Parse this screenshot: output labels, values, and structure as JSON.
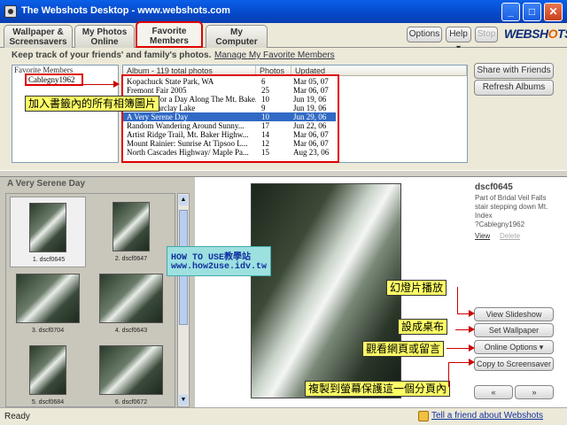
{
  "window": {
    "title": "The Webshots Desktop  -  www.webshots.com"
  },
  "tabs": [
    {
      "line1": "Wallpaper &",
      "line2": "Screensavers"
    },
    {
      "line1": "My Photos",
      "line2": "Online"
    },
    {
      "line1": "Favorite",
      "line2": "Members"
    },
    {
      "line1": "My",
      "line2": "Computer"
    }
  ],
  "toolbar": {
    "options": "Options",
    "help": "Help ▾",
    "stop": "Stop"
  },
  "logo": {
    "part1": "WEBSH",
    "part2": "O",
    "part3": "TS"
  },
  "favorites": {
    "tagline": "Keep track of your friends' and family's photos.",
    "manage_link": "Manage My Favorite Members",
    "members_header": "Favorite Members",
    "members": [
      "Cablegny1962"
    ],
    "share_button": "Share with Friends",
    "refresh_button": "Refresh Albums"
  },
  "albums": {
    "columns": [
      "Album - 119 total photos",
      "Photos",
      "Updated"
    ],
    "rows": [
      {
        "name": "Kopachuck State Park, WA",
        "photos": "6",
        "updated": "Mar 05, 07"
      },
      {
        "name": "Fremont Fair 2005",
        "photos": "25",
        "updated": "Mar 06, 07"
      },
      {
        "name": "Stopping for a Day Along The Mt. Bake...",
        "photos": "10",
        "updated": "Jun 19, 06"
      },
      {
        "name": "Hike to Barclay Lake",
        "photos": "9",
        "updated": "Jun 19, 06"
      },
      {
        "name": "A Very Serene Day",
        "photos": "10",
        "updated": "Jun 29, 06"
      },
      {
        "name": "Random Wandering Around Sunny...",
        "photos": "17",
        "updated": "Jun 22, 06"
      },
      {
        "name": "Artist Ridge Trail, Mt. Baker Highw...",
        "photos": "14",
        "updated": "Mar 06, 07"
      },
      {
        "name": "Mount Rainier: Sunrise At Tipsoo L...",
        "photos": "12",
        "updated": "Mar 06, 07"
      },
      {
        "name": "North Cascades Highway/ Maple Pa...",
        "photos": "15",
        "updated": "Aug 23, 06"
      }
    ]
  },
  "annotations": {
    "add_albums": "加入書籤內的所有相簿圖片",
    "slideshow": "幻燈片播放",
    "wallpaper": "設成桌布",
    "online": "觀看網頁或留言",
    "screensaver": "複製到螢幕保護這一個分頁內",
    "watermark_line1": "HOW TO USE教學站",
    "watermark_line2": "www.how2use.idv.tw"
  },
  "album_view": {
    "title": "A Very Serene Day",
    "thumbs": [
      "1. dscf0645",
      "2. dscf0647",
      "3. dscf0704",
      "4. dscf0643",
      "5. dscf0684",
      "6. dscf0672"
    ]
  },
  "photo": {
    "name": "dscf0645",
    "description": "Part of Bridal Veil Falls stair stepping down Mt. Index",
    "credit": "?Cablegny1962",
    "view_link": "View",
    "delete_link": "Delete"
  },
  "actions": {
    "slideshow": "View Slideshow",
    "wallpaper": "Set Wallpaper",
    "online": "Online Options ▾",
    "screensaver": "Copy to Screensaver",
    "prev": "«",
    "next": "»"
  },
  "status": {
    "text": "Ready",
    "tell_friend": "Tell a friend about Webshots"
  },
  "colors": {
    "title_blue": "#0548c8",
    "selection": "#316ac5",
    "callout": "#ffff66",
    "annotation_red": "#e00000"
  }
}
